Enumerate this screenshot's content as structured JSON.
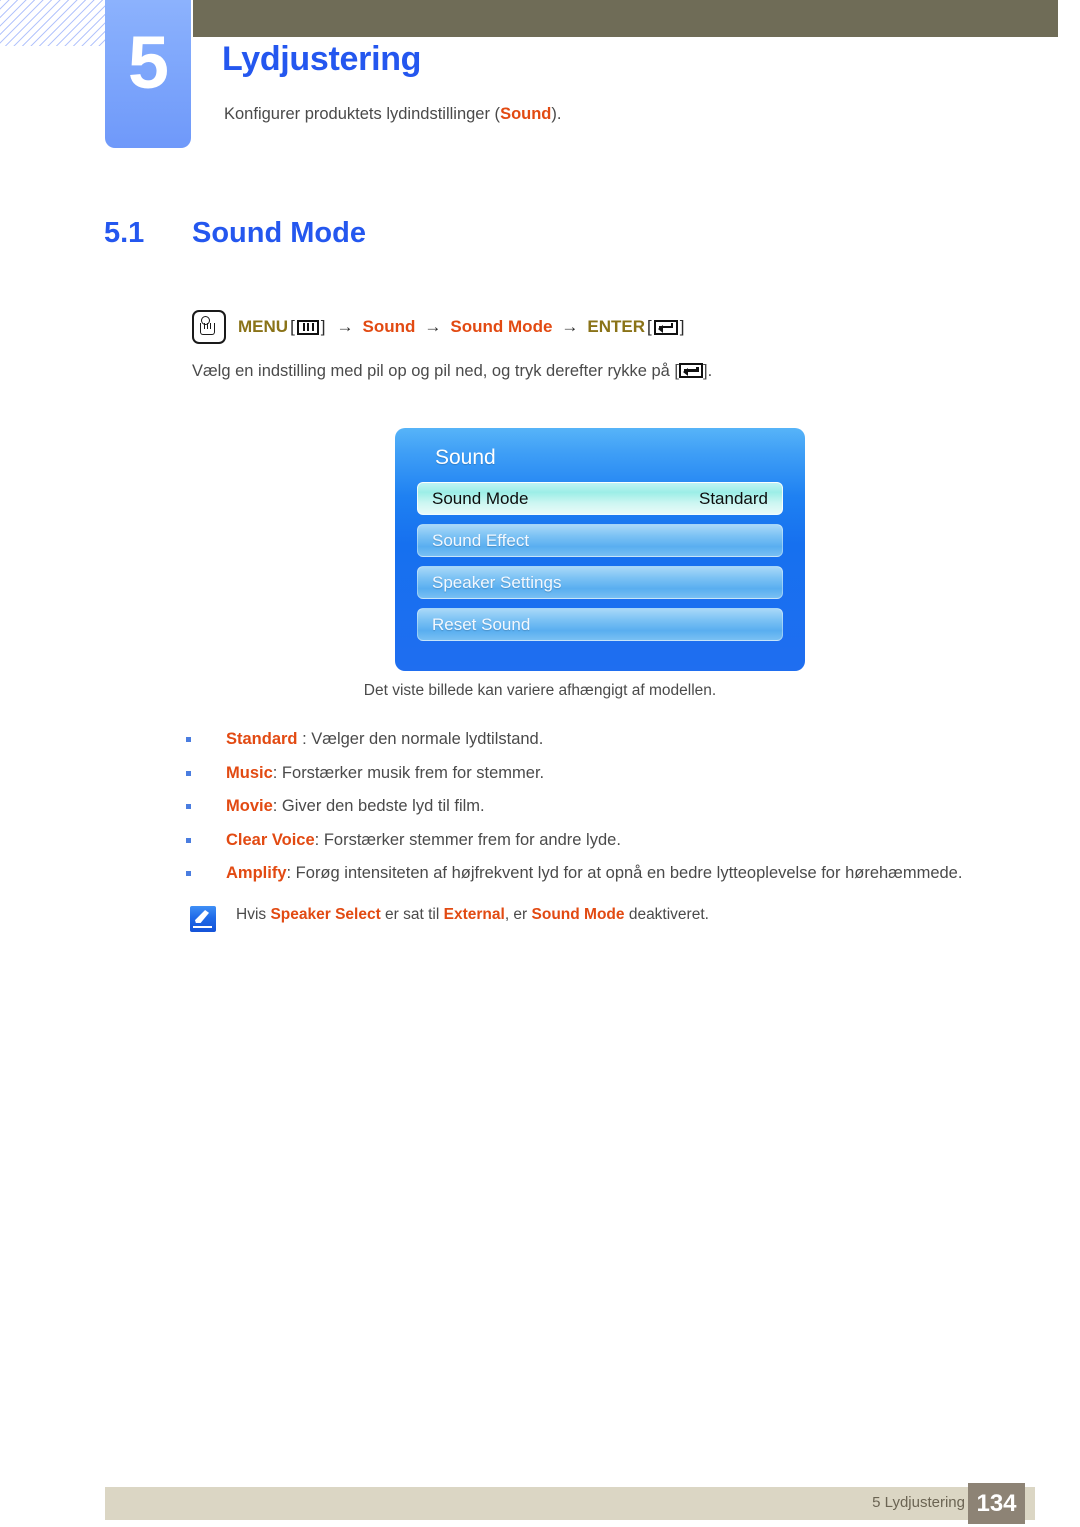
{
  "chapter": {
    "number": "5",
    "title": "Lydjustering",
    "subtitle_before": "Konfigurer produktets lydindstillinger (",
    "subtitle_keyword": "Sound",
    "subtitle_after": ")."
  },
  "section": {
    "number": "5.1",
    "title": "Sound Mode"
  },
  "menu_path": {
    "hand_icon": "hand-press-icon",
    "menu_label": "MENU",
    "menu_glyph": "menu-bars-icon",
    "arrow": "→",
    "step1": "Sound",
    "step2": "Sound Mode",
    "enter_label": "ENTER",
    "enter_glyph": "enter-key-icon",
    "bracket_open": "[",
    "bracket_close": "]"
  },
  "instruction": {
    "text_before": "Vælg en indstilling med pil op og pil ned, og tryk derefter rykke på [",
    "text_after": "]."
  },
  "osd": {
    "title": "Sound",
    "rows": [
      {
        "label": "Sound Mode",
        "value": "Standard",
        "selected": true
      },
      {
        "label": "Sound Effect",
        "value": "",
        "selected": false
      },
      {
        "label": "Speaker Settings",
        "value": "",
        "selected": false
      },
      {
        "label": "Reset Sound",
        "value": "",
        "selected": false
      }
    ],
    "caption": "Det viste billede kan variere afhængigt af modellen."
  },
  "bullets": [
    {
      "term": "Standard",
      "desc": " : Vælger den normale lydtilstand."
    },
    {
      "term": "Music",
      "desc": ": Forstærker musik frem for stemmer."
    },
    {
      "term": "Movie",
      "desc": ": Giver den bedste lyd til film."
    },
    {
      "term": "Clear Voice",
      "desc": ": Forstærker stemmer frem for andre lyde."
    },
    {
      "term": "Amplify",
      "desc": ": Forøg intensiteten af højfrekvent lyd for at opnå en bedre lytteoplevelse for hørehæmmede."
    }
  ],
  "note": {
    "icon": "note-pencil-icon",
    "p1": "Hvis ",
    "kw1": "Speaker Select",
    "p2": " er sat til ",
    "kw2": "External",
    "p3": ", er ",
    "kw3": "Sound Mode",
    "p4": " deaktiveret."
  },
  "footer": {
    "text": "5 Lydjustering",
    "page": "134"
  },
  "colors": {
    "accent_blue": "#2457ef",
    "keyword_orange": "#e24a12",
    "menu_gold": "#8a7318",
    "olive_bar": "#6f6c57",
    "tab_blue": "#7ba4fb",
    "footer_bar": "#dbd6c4",
    "page_box": "#8d8375"
  }
}
